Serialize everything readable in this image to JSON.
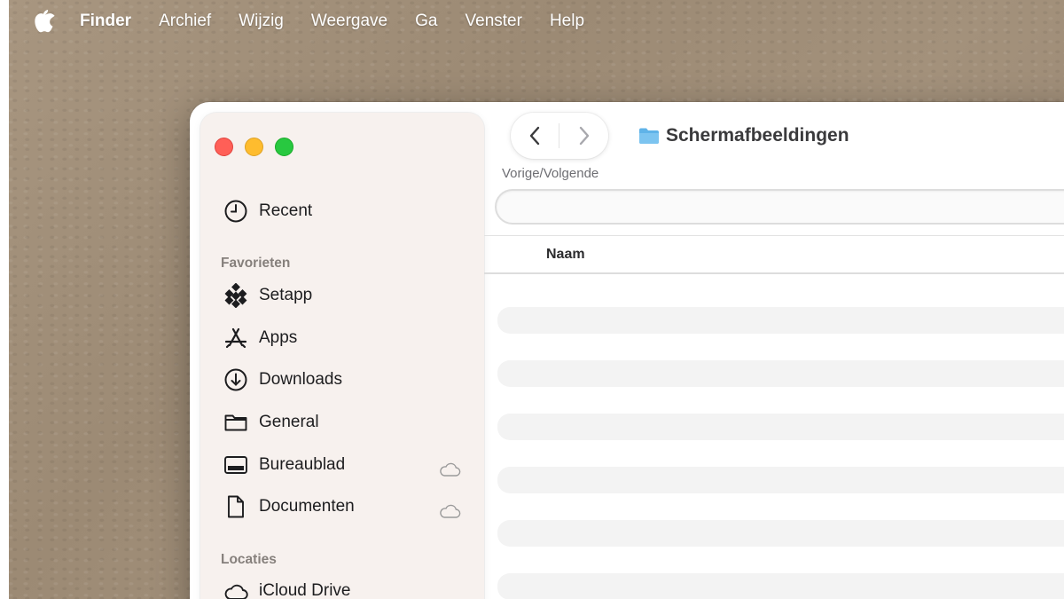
{
  "menubar": {
    "app_name": "Finder",
    "items": [
      "Archief",
      "Wijzig",
      "Weergave",
      "Ga",
      "Venster",
      "Help"
    ]
  },
  "window": {
    "title": "Schermafbeeldingen",
    "nav_caption": "Vorige/Volgende",
    "search": {
      "value": "",
      "placeholder": ""
    },
    "columns": {
      "name": "Naam"
    },
    "rows": [
      "",
      "",
      "",
      "",
      "",
      ""
    ]
  },
  "sidebar": {
    "recent": {
      "label": "Recent",
      "icon": "clock-icon"
    },
    "favorites_heading": "Favorieten",
    "favorites": [
      {
        "label": "Setapp",
        "icon": "setapp-icon"
      },
      {
        "label": "Apps",
        "icon": "apps-icon"
      },
      {
        "label": "Downloads",
        "icon": "download-icon"
      },
      {
        "label": "General",
        "icon": "folder-icon"
      },
      {
        "label": "Bureaublad",
        "icon": "desktop-icon",
        "icloud": true
      },
      {
        "label": "Documenten",
        "icon": "document-icon",
        "icloud": true
      }
    ],
    "locations_heading": "Locaties",
    "locations": [
      {
        "label": "iCloud Drive",
        "icon": "cloud-icon"
      }
    ]
  },
  "colors": {
    "close": "#ff5f57",
    "minimize": "#febc2e",
    "zoom": "#28c840",
    "folder": "#5fb3e8",
    "sidebar_bg": "#f7f1ee"
  }
}
